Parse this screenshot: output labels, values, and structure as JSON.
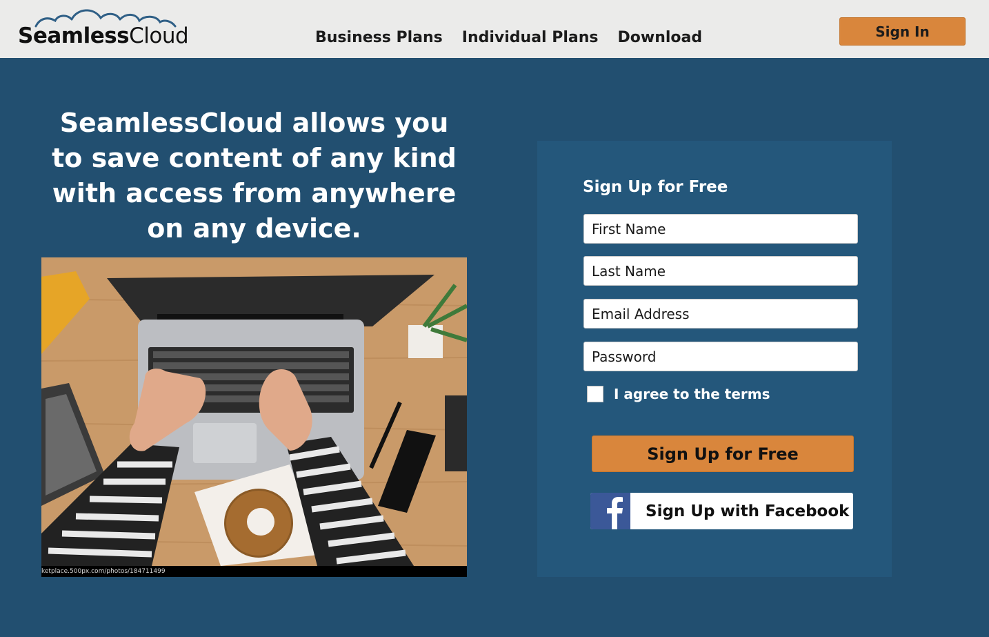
{
  "brand": {
    "logo_part1": "Seamless",
    "logo_part2": "Cloud",
    "logo_icon": "cloud-icon",
    "colors": {
      "header_bg": "#ebebea",
      "page_bg": "#224f70",
      "panel_bg": "#24577b",
      "accent": "#d9863c",
      "facebook": "#3b5898"
    }
  },
  "nav": {
    "items": [
      {
        "label": "Business Plans"
      },
      {
        "label": "Individual Plans"
      },
      {
        "label": "Download"
      }
    ],
    "signin_label": "Sign In"
  },
  "hero": {
    "headline": "SeamlessCloud allows you to save content of any kind with access from anywhere on any device.",
    "photo_caption": "ketplace.500px.com/photos/184711499"
  },
  "signup": {
    "title": "Sign Up for Free",
    "fields": {
      "first_name": {
        "placeholder": "First Name",
        "value": ""
      },
      "last_name": {
        "placeholder": "Last Name",
        "value": ""
      },
      "email": {
        "placeholder": "Email Address",
        "value": ""
      },
      "password": {
        "placeholder": "Password",
        "value": ""
      }
    },
    "terms_label": "I agree to the terms",
    "terms_checked": false,
    "submit_label": "Sign Up for Free",
    "facebook_label": "Sign Up with Facebook",
    "facebook_icon": "facebook-icon"
  }
}
